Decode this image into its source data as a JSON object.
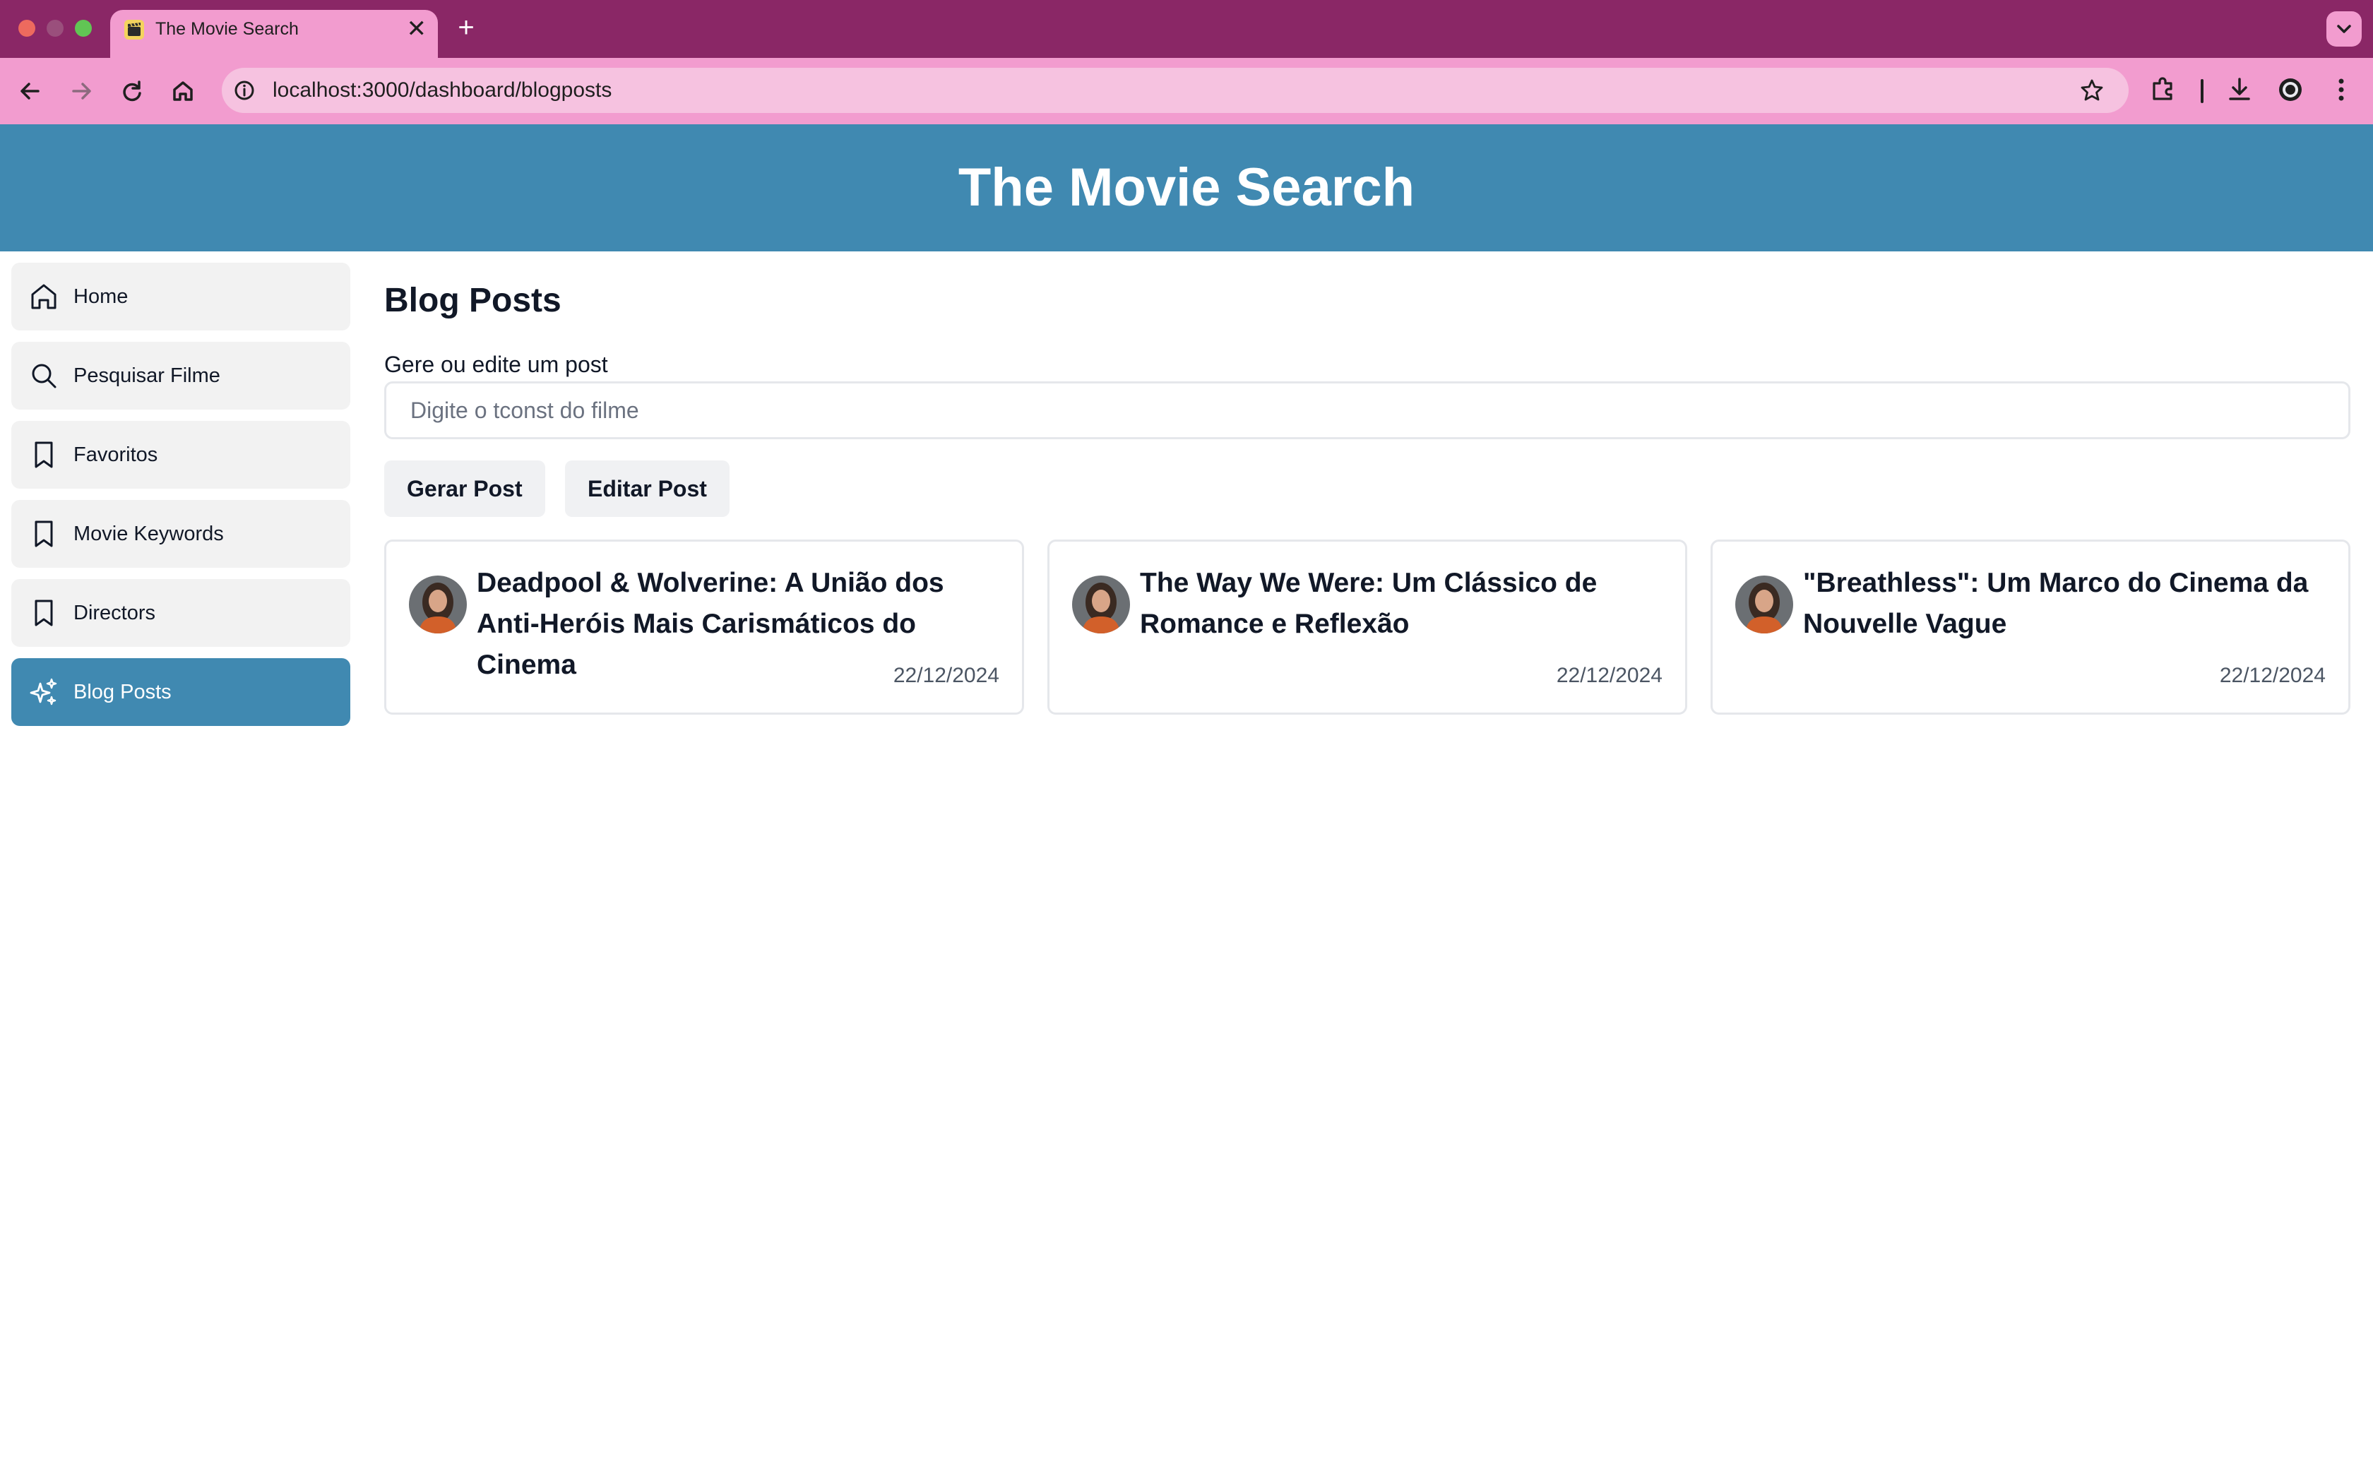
{
  "browser": {
    "tab_title": "The Movie Search",
    "tab_close": "✕",
    "new_tab": "+",
    "url": "localhost:3000/dashboard/blogposts"
  },
  "header": {
    "title": "The Movie Search"
  },
  "sidebar": {
    "items": [
      {
        "label": "Home",
        "icon": "home-icon",
        "active": false
      },
      {
        "label": "Pesquisar Filme",
        "icon": "search-icon",
        "active": false
      },
      {
        "label": "Favoritos",
        "icon": "bookmark-icon",
        "active": false
      },
      {
        "label": "Movie Keywords",
        "icon": "bookmark-icon",
        "active": false
      },
      {
        "label": "Directors",
        "icon": "bookmark-icon",
        "active": false
      },
      {
        "label": "Blog Posts",
        "icon": "sparkles-icon",
        "active": true
      }
    ]
  },
  "main": {
    "title": "Blog Posts",
    "form_label": "Gere ou edite um post",
    "input_placeholder": "Digite o tconst do filme",
    "input_value": "",
    "generate_button": "Gerar Post",
    "edit_button": "Editar Post",
    "posts": [
      {
        "title": "Deadpool & Wolverine: A União dos Anti-Heróis Mais Carismáticos do Cinema",
        "date": "22/12/2024"
      },
      {
        "title": "The Way We Were: Um Clássico de Romance e Reflexão",
        "date": "22/12/2024"
      },
      {
        "title": "\"Breathless\": Um Marco do Cinema da Nouvelle Vague",
        "date": "22/12/2024"
      }
    ]
  },
  "colors": {
    "tabstrip": "#8a2766",
    "toolbar": "#f29ccf",
    "header": "#4089b1",
    "active_nav": "#4089b1"
  }
}
